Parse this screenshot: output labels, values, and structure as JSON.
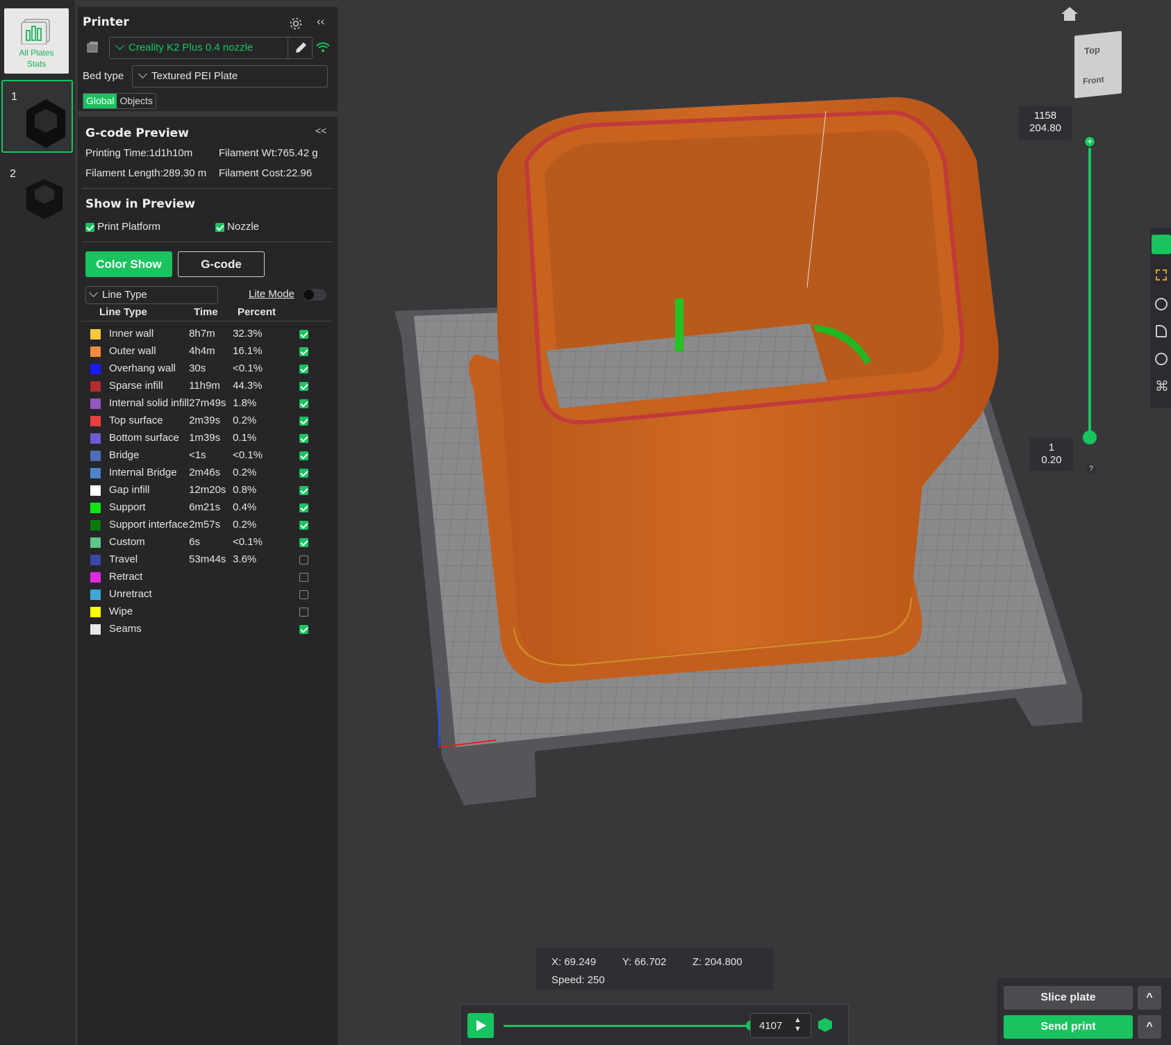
{
  "thumbs": {
    "all_plates_label_1": "All Plates",
    "all_plates_label_2": "Stats",
    "plates": [
      {
        "num": "1"
      },
      {
        "num": "2"
      }
    ]
  },
  "printer": {
    "title": "Printer",
    "name": "Creality K2 Plus 0.4 nozzle",
    "bed_type_label": "Bed type",
    "bed_type": "Textured PEI Plate",
    "tab_global": "Global",
    "tab_objects": "Objects"
  },
  "gcode": {
    "title": "G-code Preview",
    "collapse": "<<",
    "printing_time": "Printing Time:1d1h10m",
    "filament_wt": "Filament Wt:765.42 g",
    "filament_length": "Filament Length:289.30 m",
    "filament_cost": "Filament Cost:22.96"
  },
  "show": {
    "title": "Show in Preview",
    "print_platform": "Print Platform",
    "nozzle": "Nozzle",
    "color_show": "Color Show",
    "gcode_btn": "G-code",
    "view_select": "Line Type",
    "lite_mode": "Lite Mode"
  },
  "line_table": {
    "headers": [
      "Line Type",
      "Time",
      "Percent"
    ],
    "rows": [
      {
        "name": "Inner wall",
        "time": "8h7m",
        "percent": "32.3%",
        "color": "#f7c83c",
        "checked": true
      },
      {
        "name": "Outer wall",
        "time": "4h4m",
        "percent": "16.1%",
        "color": "#f58a3a",
        "checked": true
      },
      {
        "name": "Overhang wall",
        "time": "30s",
        "percent": "<0.1%",
        "color": "#1a1aff",
        "checked": true
      },
      {
        "name": "Sparse infill",
        "time": "11h9m",
        "percent": "44.3%",
        "color": "#b52d2d",
        "checked": true
      },
      {
        "name": "Internal solid infill",
        "time": "27m49s",
        "percent": "1.8%",
        "color": "#9457c2",
        "checked": true
      },
      {
        "name": "Top surface",
        "time": "2m39s",
        "percent": "0.2%",
        "color": "#e8403d",
        "checked": true
      },
      {
        "name": "Bottom surface",
        "time": "1m39s",
        "percent": "0.1%",
        "color": "#6b5bd6",
        "checked": true
      },
      {
        "name": "Bridge",
        "time": "<1s",
        "percent": "<0.1%",
        "color": "#4e6fb8",
        "checked": true
      },
      {
        "name": "Internal Bridge",
        "time": "2m46s",
        "percent": "0.2%",
        "color": "#4f84c9",
        "checked": true
      },
      {
        "name": "Gap infill",
        "time": "12m20s",
        "percent": "0.8%",
        "color": "#ffffff",
        "checked": true
      },
      {
        "name": "Support",
        "time": "6m21s",
        "percent": "0.4%",
        "color": "#12e612",
        "checked": true
      },
      {
        "name": "Support interface",
        "time": "2m57s",
        "percent": "0.2%",
        "color": "#0b7a0b",
        "checked": true
      },
      {
        "name": "Custom",
        "time": "6s",
        "percent": "<0.1%",
        "color": "#5cc98a",
        "checked": true
      },
      {
        "name": "Travel",
        "time": "53m44s",
        "percent": "3.6%",
        "color": "#3a48a8",
        "checked": false
      },
      {
        "name": "Retract",
        "time": "",
        "percent": "",
        "color": "#e02ae0",
        "checked": false
      },
      {
        "name": "Unretract",
        "time": "",
        "percent": "",
        "color": "#40a8d8",
        "checked": false
      },
      {
        "name": "Wipe",
        "time": "",
        "percent": "",
        "color": "#ffff00",
        "checked": false
      },
      {
        "name": "Seams",
        "time": "",
        "percent": "",
        "color": "#e8e8e8",
        "checked": true
      }
    ]
  },
  "viewport": {
    "cube_top": "Top",
    "cube_front": "Front",
    "layer_top_num": "1158",
    "layer_top_height": "204.80",
    "layer_bottom_num": "1",
    "layer_bottom_height": "0.20",
    "help": "?",
    "coord_x": "X: 69.249",
    "coord_y": "Y: 66.702",
    "coord_z": "Z: 204.800",
    "speed": "Speed: 250",
    "move_value": "4107",
    "move_progress": 1.0
  },
  "actions": {
    "slice_plate": "Slice plate",
    "send_print": "Send print",
    "expand": "^"
  },
  "colors": {
    "accent": "#19c35f",
    "model": "#c8621f",
    "panel_bg": "#262628",
    "viewport_bg": "#38383b"
  }
}
